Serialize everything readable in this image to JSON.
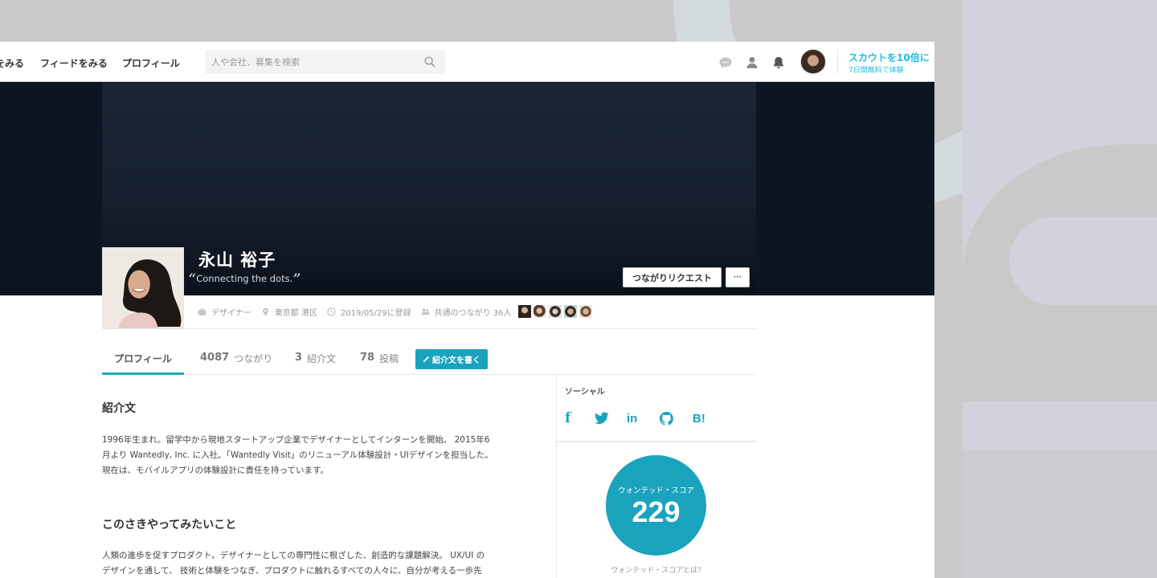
{
  "nav": {
    "link_explore": "をみる",
    "link_feed": "フィードをみる",
    "link_profile": "プロフィール",
    "search_placeholder": "人や会社、募集を検索",
    "scout_title": "スカウトを10倍に",
    "scout_sub": "7日間無料で体験",
    "icons": [
      "chat-icon",
      "user-icon",
      "bell-icon",
      "search-icon"
    ]
  },
  "profile": {
    "name": "永山 裕子",
    "tagline_open": "“",
    "tagline": "Connecting the dots.",
    "tagline_close": "”",
    "connect_button": "つながりリクエスト",
    "more_button": "···",
    "meta": {
      "role": "デザイナー",
      "location": "東京都 港区",
      "registered": "2019/05/29に登録",
      "mutual": "共通のつながり 36人"
    }
  },
  "tabs": {
    "profile": "プロフィール",
    "connections_count": "4087",
    "connections_label": "つながり",
    "intros_count": "3",
    "intros_label": "紹介文",
    "posts_count": "78",
    "posts_label": "投稿",
    "write_button": "紹介文を書く"
  },
  "main": {
    "intro_title": "紹介文",
    "intro_lines": [
      "1996年生まれ。留学中から現地スタートアップ企業でデザイナーとしてインターンを開始。 2015年6",
      "月より Wantedly, Inc. に入社。「Wantedly Visit」のリニューアル体験設計・UIデザインを担当した。",
      "現在は、モバイルアプリの体験設計に責任を持っています。"
    ],
    "future_title": "このさきやってみたいこと",
    "future_lines": [
      "人類の進歩を促すプロダクト。デザイナーとしての専門性に根ざした、創造的な課題解決。 UX/UI の",
      "デザインを通して、 技術と体験をつなぎ、プロダクトに触れるすべての人々に、自分が考える一歩先"
    ]
  },
  "side": {
    "social_label": "ソーシャル",
    "social": {
      "facebook": "f",
      "linkedin": "in",
      "hatena": "B!"
    },
    "score_label": "ウォンテッド・スコア",
    "score_value": "229",
    "score_link": "ウォンテッド・スコアとは?"
  },
  "colors": {
    "accent": "#1aa3bd",
    "scout": "#21bddb",
    "cover": "#0d1522"
  }
}
